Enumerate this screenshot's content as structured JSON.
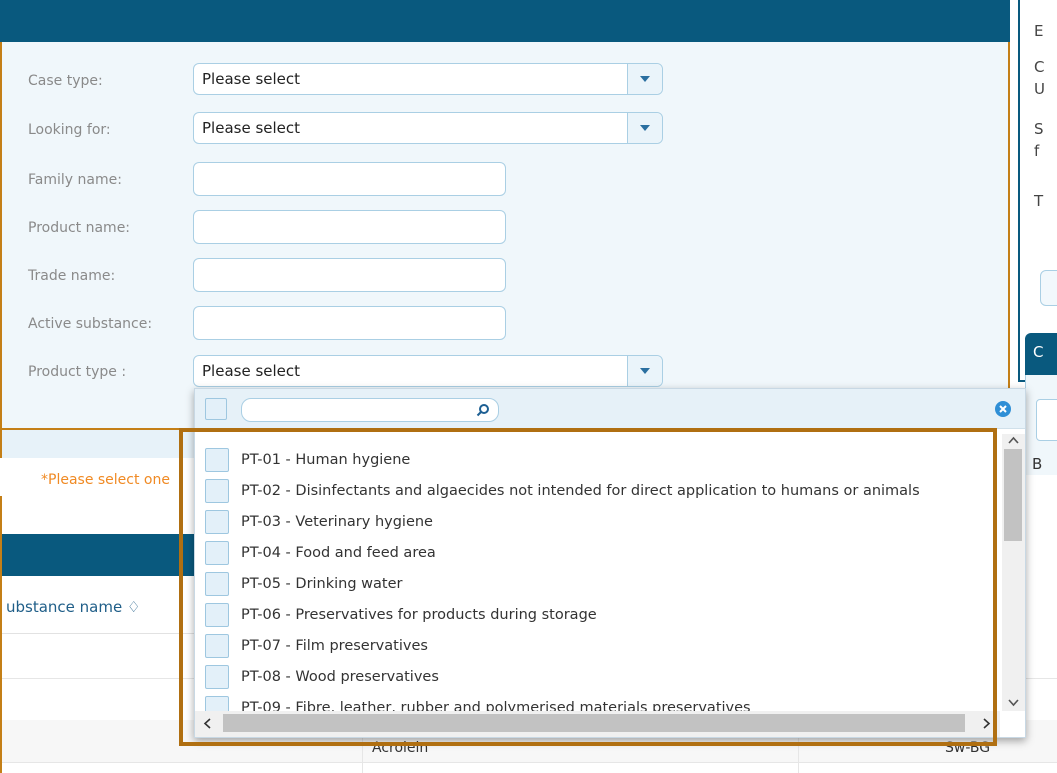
{
  "form": {
    "case_type": {
      "label": "Case type:",
      "value": "Please select"
    },
    "looking_for": {
      "label": "Looking for:",
      "value": "Please select"
    },
    "family_name": {
      "label": "Family name:",
      "value": ""
    },
    "product_name": {
      "label": "Product name:",
      "value": ""
    },
    "trade_name": {
      "label": "Trade name:",
      "value": ""
    },
    "active_substance": {
      "label": "Active substance:",
      "value": ""
    },
    "product_type": {
      "label": "Product type :",
      "value": "Please select"
    },
    "note": "*Please select one"
  },
  "results": {
    "column_substance": "ubstance name ♢",
    "row_partial_left": "Acrolein",
    "row_partial_right": "Sw-BG"
  },
  "right_panel": {
    "letters": [
      "E",
      "C",
      "U",
      "S",
      "f",
      "T"
    ],
    "header_letter": "C",
    "box_letter": "B"
  },
  "dropdown": {
    "options": [
      "PT-01 - Human hygiene",
      "PT-02 - Disinfectants and algaecides not intended for direct application to humans or animals",
      "PT-03 - Veterinary hygiene",
      "PT-04 - Food and feed area",
      "PT-05 - Drinking water",
      "PT-06 - Preservatives for products during storage",
      "PT-07 - Film preservatives",
      "PT-08 - Wood preservatives",
      "PT-09 - Fibre, leather, rubber and polymerised materials preservatives"
    ]
  },
  "colors": {
    "header": "#09597e",
    "accent": "#f08a24",
    "highlight": "#b06f11"
  },
  "icons": [
    "dropdown-arrow-icon",
    "search-icon",
    "clear-icon",
    "scroll-up-icon",
    "scroll-down-icon",
    "scroll-left-icon",
    "scroll-right-icon"
  ]
}
